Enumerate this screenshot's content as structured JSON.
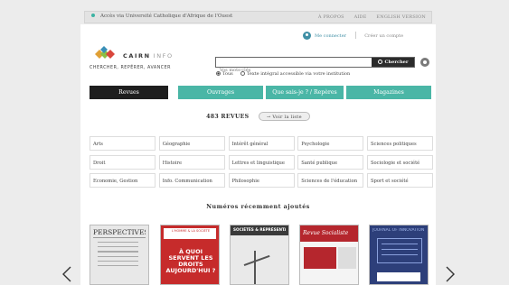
{
  "topbar": {
    "access_text": "Accès via Université Catholique d'Afrique de l'Ouest",
    "links": [
      "À propos",
      "Aide",
      "English version"
    ]
  },
  "account": {
    "login": "Me connecter",
    "create": "Créer un compte"
  },
  "logo": {
    "word": "CAIRN",
    "suffix": "INFO",
    "tagline": "CHERCHER, REPÉRER, AVANCER"
  },
  "search": {
    "placeholder": "Vos mots-clés",
    "button": "Chercher",
    "option_all": "Tous",
    "option_fulltext": "Texte intégral accessible via votre institution"
  },
  "tabs": [
    {
      "label": "Revues"
    },
    {
      "label": "Ouvrages"
    },
    {
      "label": "Que sais-je ? / Repères"
    },
    {
      "label": "Magazines"
    }
  ],
  "revues": {
    "count": "483 REVUES",
    "list_button": "Voir la liste"
  },
  "disciplines": [
    "Arts",
    "Géographie",
    "Intérêt général",
    "Psychologie",
    "Sciences politiques",
    "Droit",
    "Histoire",
    "Lettres et linguistique",
    "Santé publique",
    "Sociologie et société",
    "Economie, Gestion",
    "Info. Communication",
    "Philosophie",
    "Sciences de l'éducation",
    "Sport et société"
  ],
  "recent": {
    "title": "Numéros récemment ajoutés"
  },
  "covers": [
    {
      "title": "PERSPECTIVES PSY"
    },
    {
      "title": "L'HOMME & LA SOCIÉTÉ",
      "headline": "À QUOI SERVENT LES DROITS AUJOURD'HUI ?"
    },
    {
      "title": "SOCIÉTÉS & REPRÉSENTATIONS"
    },
    {
      "title": "Revue Socialiste"
    },
    {
      "title": "JOURNAL OF INNOVATION ECONOMICS"
    }
  ],
  "colors": {
    "accent": "#4ab6a6",
    "tab_active": "#1e1e1e",
    "link": "#3f8fa5"
  }
}
